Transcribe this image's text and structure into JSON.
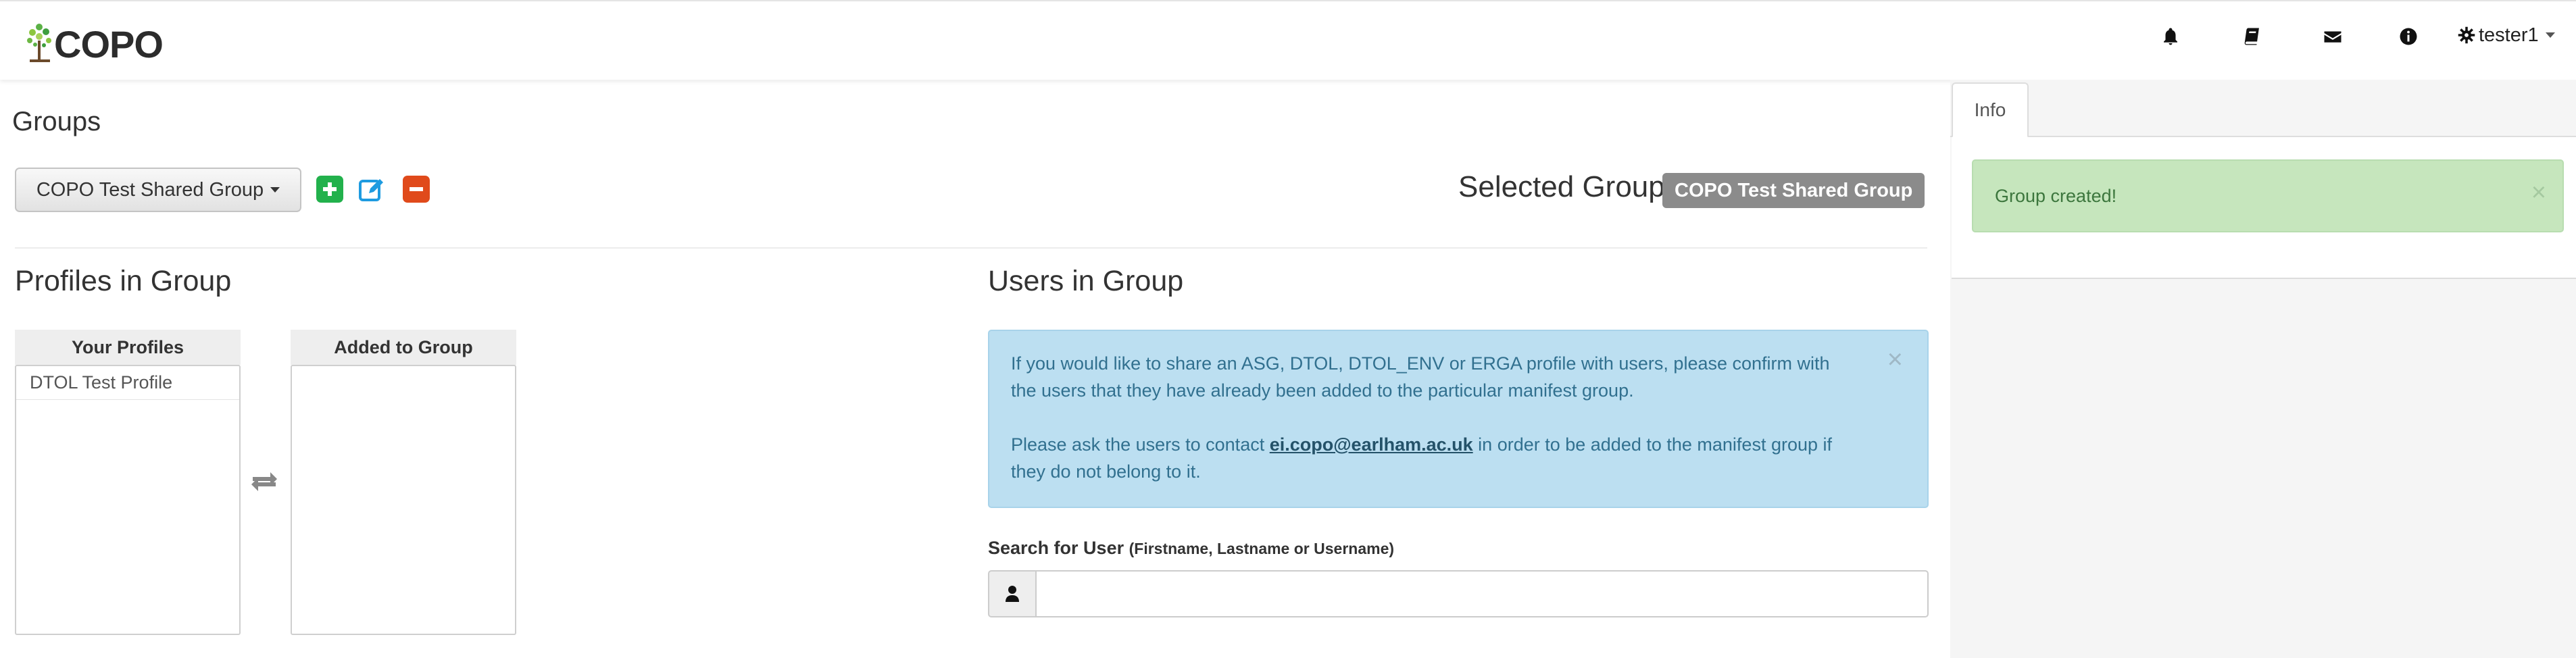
{
  "navbar": {
    "brand": "COPO",
    "icons": [
      "bell-icon",
      "book-icon",
      "envelope-icon",
      "info-icon"
    ],
    "user": "tester1"
  },
  "page": {
    "title": "Groups",
    "group_dropdown": "COPO Test Shared Group",
    "selected_group_label": "Selected Group:",
    "selected_group_value": "COPO Test Shared Group"
  },
  "profiles": {
    "title": "Profiles in Group",
    "your_profiles_header": "Your Profiles",
    "added_header": "Added to Group",
    "your_profiles": [
      "DTOL Test Profile"
    ],
    "added": []
  },
  "users": {
    "title": "Users in Group",
    "alert_p1": "If you would like to share an ASG, DTOL, DTOL_ENV or ERGA profile with users, please confirm with the users that they have already been added to the particular manifest group.",
    "alert_p2_before": "Please ask the users to contact ",
    "alert_email": "ei.copo@earlham.ac.uk",
    "alert_p2_after": " in order to be added to the manifest group if they do not belong to it.",
    "alert_close": "×",
    "search_label": "Search for User",
    "search_hint": "(Firstname, Lastname or Username)",
    "search_value": "",
    "search_placeholder": ""
  },
  "info_panel": {
    "tab": "Info",
    "message": "Group created!",
    "close": "×"
  },
  "colors": {
    "add": "#22b14c",
    "edit": "#1e9be0",
    "remove": "#e04a1b",
    "badge": "#8b8b8b",
    "info_alert_bg": "#bcdff1",
    "success_alert_bg": "#c6e6bd"
  }
}
